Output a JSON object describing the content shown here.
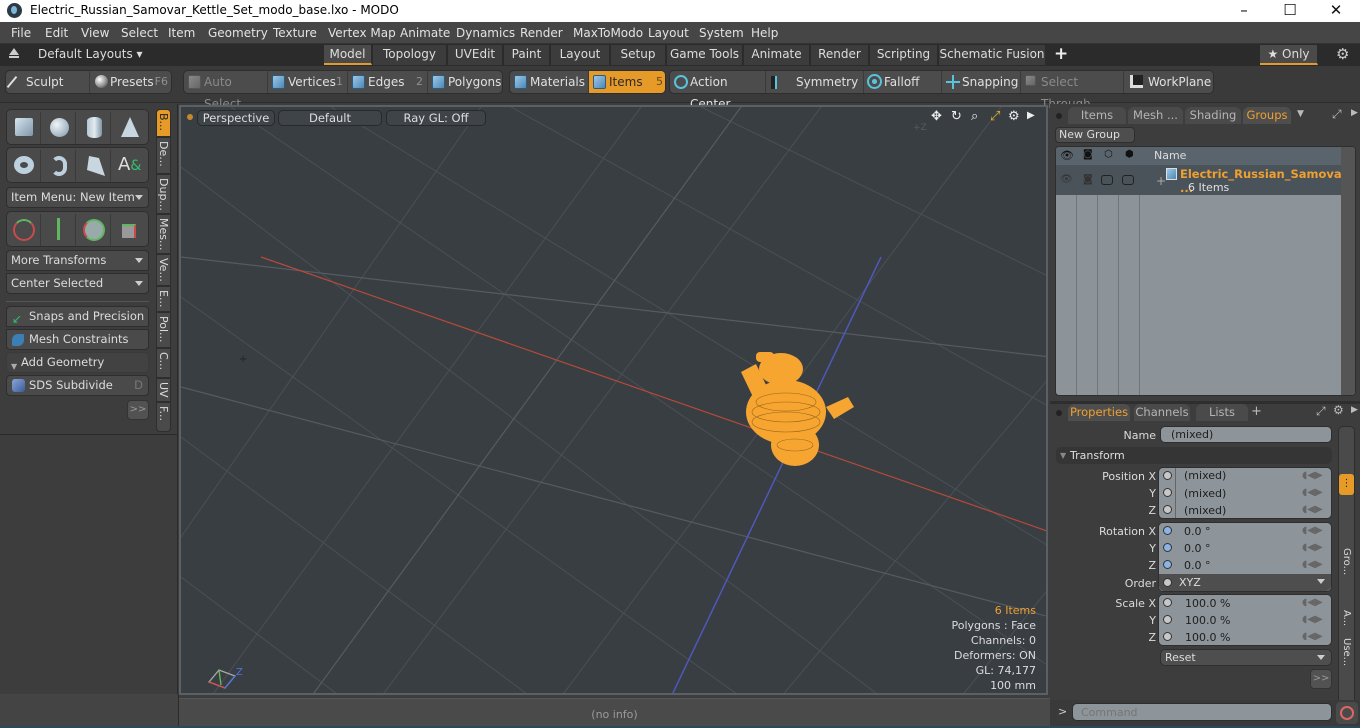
{
  "window": {
    "title": "Electric_Russian_Samovar_Kettle_Set_modo_base.lxo - MODO",
    "controls": [
      "minimize",
      "maximize",
      "close"
    ]
  },
  "menu": [
    "File",
    "Edit",
    "View",
    "Select",
    "Item",
    "Geometry",
    "Texture",
    "Vertex Map",
    "Animate",
    "Dynamics",
    "Render",
    "MaxToModo",
    "Layout",
    "System",
    "Help"
  ],
  "layouts": {
    "dropdown_label": "Default Layouts ▾",
    "tabs": [
      "Model",
      "Topology",
      "UVEdit",
      "Paint",
      "Layout",
      "Setup",
      "Game Tools",
      "Animate",
      "Render",
      "Scripting",
      "Schematic Fusion"
    ],
    "active_tab": "Model",
    "add_label": "+",
    "only_label": "★ Only"
  },
  "toolbar": {
    "sculpt": "Sculpt",
    "presets": "Presets",
    "presets_hotkey": "F6",
    "auto_select": "Auto Select",
    "vertices": "Vertices",
    "vertices_hotkey": "1",
    "edges": "Edges",
    "edges_hotkey": "2",
    "polygons": "Polygons",
    "materials": "Materials",
    "items": "Items",
    "items_hotkey": "5",
    "action_center": "Action Center",
    "symmetry": "Symmetry",
    "falloff": "Falloff",
    "snapping": "Snapping",
    "select_through": "Select Through",
    "workplane": "WorkPlane"
  },
  "left_panel": {
    "item_menu": "Item Menu: New Item",
    "more_transforms": "More Transforms",
    "center_selected": "Center Selected",
    "snaps_precision": "Snaps and Precision",
    "mesh_constraints": "Mesh Constraints",
    "add_geometry": "Add Geometry",
    "sds_subdivide": "SDS Subdivide",
    "sds_hotkey": "D",
    "more_button": ">>",
    "side_tabs": [
      "B...",
      "De...",
      "Dup...",
      "Mes...",
      "Ve...",
      "E...",
      "Pol...",
      "C...",
      "UV",
      "F..."
    ]
  },
  "viewport": {
    "view_mode": "Perspective",
    "shading": "Default",
    "raygl": "Ray GL: Off",
    "axis_label": "+Z",
    "hud": {
      "items": "6 Items",
      "polygons": "Polygons : Face",
      "channels": "Channels: 0",
      "deformers": "Deformers: ON",
      "gl": "GL: 74,177",
      "scale": "100 mm"
    },
    "selection_color": "#f7a531"
  },
  "right_top": {
    "tabs": [
      "Items",
      "Mesh ...",
      "Shading",
      "Groups"
    ],
    "active_tab": "Groups",
    "new_group": "New Group",
    "column_name": "Name",
    "group_name": "Electric_Russian_Samova ...",
    "group_count": "6 Items"
  },
  "properties": {
    "tabs": [
      "Properties",
      "Channels",
      "Lists"
    ],
    "active_tab": "Properties",
    "add_label": "+",
    "name_label": "Name",
    "name_value": "(mixed)",
    "transform_section": "Transform",
    "position_label": "Position X",
    "position": [
      "(mixed)",
      "(mixed)",
      "(mixed)"
    ],
    "rotation_label": "Rotation X",
    "rotation": [
      "0.0 °",
      "0.0 °",
      "0.0 °"
    ],
    "order_label": "Order",
    "order_value": "XYZ",
    "scale_label": "Scale X",
    "scale": [
      "100.0 %",
      "100.0 %",
      "100.0 %"
    ],
    "y_label": "Y",
    "z_label": "Z",
    "reset": "Reset",
    "more_button": ">>",
    "side_tabs": [
      "Gro...",
      "A...",
      "Use..."
    ]
  },
  "status": {
    "info": "(no info)",
    "command_prompt": ">",
    "command_placeholder": "Command"
  }
}
